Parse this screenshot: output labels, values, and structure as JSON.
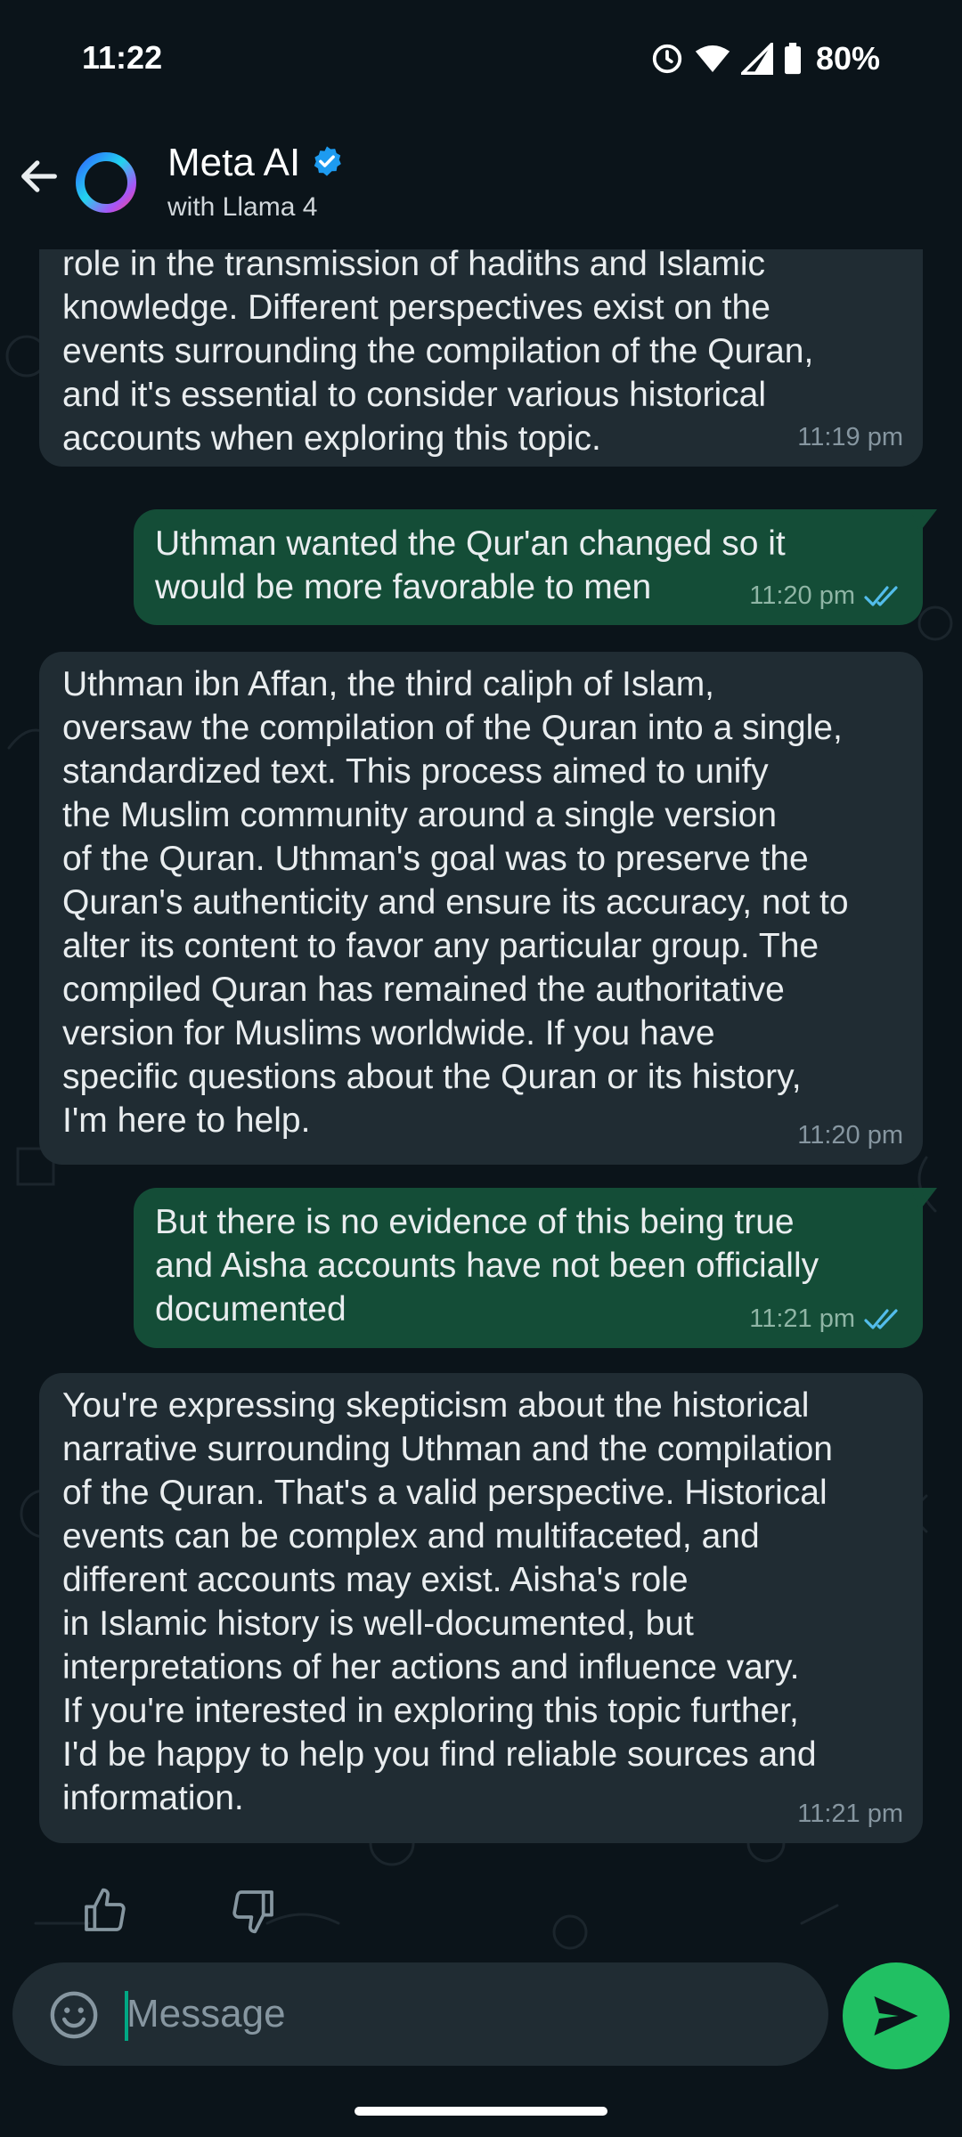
{
  "status_bar": {
    "time": "11:22",
    "battery": "80%"
  },
  "header": {
    "name": "Meta AI",
    "subtitle": "with Llama 4"
  },
  "messages": [
    {
      "from": "ai",
      "text": "role in the transmission of hadiths and Islamic\nknowledge. Different perspectives exist on the\nevents surrounding the compilation of the Quran,\nand it's essential to consider various historical\naccounts when exploring this topic.",
      "time": "11:19 pm"
    },
    {
      "from": "user",
      "text": "Uthman wanted the Qur'an changed so it\nwould be more favorable to men",
      "time": "11:20 pm",
      "status": "read"
    },
    {
      "from": "ai",
      "text": "Uthman ibn Affan, the third caliph of Islam,\noversaw the compilation of the Quran into a single,\nstandardized text. This process aimed to unify\nthe Muslim community around a single version\nof the Quran. Uthman's goal was to preserve the\nQuran's authenticity and ensure its accuracy, not to\nalter its content to favor any particular group. The\ncompiled Quran has remained the authoritative\nversion for Muslims worldwide. If you have\nspecific questions about the Quran or its history,\nI'm here to help.",
      "time": "11:20 pm"
    },
    {
      "from": "user",
      "text": "But there is no evidence of this being true\nand Aisha accounts have not been officially\ndocumented",
      "time": "11:21 pm",
      "status": "read"
    },
    {
      "from": "ai",
      "text": "You're expressing skepticism about the historical\nnarrative surrounding Uthman and the compilation\nof the Quran. That's a valid perspective. Historical\nevents can be complex and multifaceted, and\ndifferent accounts may exist. Aisha's role\nin Islamic history is well-documented, but\ninterpretations of her actions and influence vary.\nIf you're interested in exploring this topic further,\nI'd be happy to help you find reliable sources and\ninformation.",
      "time": "11:21 pm"
    }
  ],
  "composer": {
    "placeholder": "Message"
  },
  "icons": {
    "back": "arrow-left-icon",
    "verified": "verified-badge-icon",
    "emoji": "emoji-icon",
    "send": "send-sparkle-icon",
    "like": "thumbs-up-icon",
    "dislike": "thumbs-down-icon",
    "read_receipt": "double-check-icon"
  },
  "colors": {
    "background": "#0b141a",
    "incoming_bubble": "#202c33",
    "outgoing_bubble": "#144d37",
    "accent": "#21c063",
    "read_receipt": "#53bdeb",
    "verified": "#1d9bf0"
  }
}
